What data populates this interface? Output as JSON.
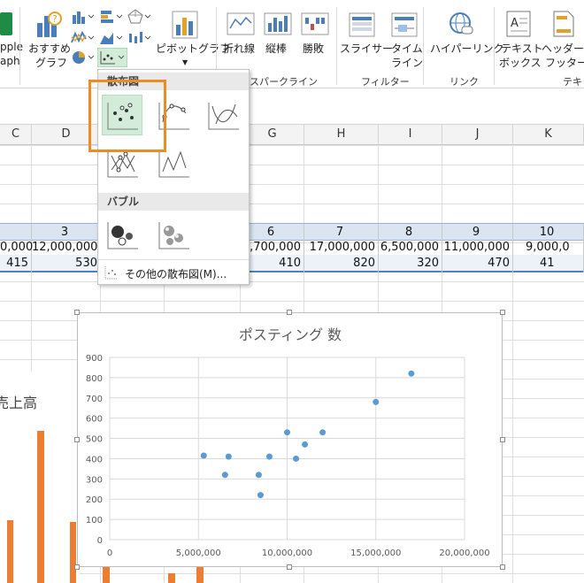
{
  "ribbon": {
    "apple_graph_label_1": "pple",
    "apple_graph_label_2": "aph",
    "recommended_label_1": "おすすめ",
    "recommended_label_2": "グラフ",
    "pivot_label": "ピボットグラフ",
    "line_label": "折れ線",
    "column_label": "縦棒",
    "winloss_label": "勝敗",
    "slicer_label": "スライサー",
    "timeline_label_1": "タイム",
    "timeline_label_2": "ライン",
    "hyperlink_label": "ハイパーリンク",
    "textbox_label_1": "テキスト",
    "textbox_label_2": "ボックス",
    "header_label_1": "ヘッダーと",
    "header_label_2": "フッター",
    "group_sparkline": "スパークライン",
    "group_filter": "フィルター",
    "group_link": "リンク",
    "group_text": "テキ"
  },
  "dropdown": {
    "scatter_header": "散布図",
    "bubble_header": "バブル",
    "more_label": "その他の散布図(M)..."
  },
  "columns": [
    "C",
    "D",
    "",
    "",
    "G",
    "H",
    "I",
    "J",
    "K"
  ],
  "row_numbers": [
    "",
    "3",
    "",
    "",
    "6",
    "7",
    "8",
    "9",
    "10"
  ],
  "row_sales": [
    "0,000",
    "12,000,000",
    "",
    "",
    "6,700,000",
    "17,000,000",
    "6,500,000",
    "11,000,000",
    "9,000,0"
  ],
  "row_posts": [
    "415",
    "530",
    "",
    "",
    "410",
    "820",
    "320",
    "470",
    "41"
  ],
  "bg_chart_title": "売上高",
  "chart_data": {
    "type": "scatter",
    "title": "ポスティング 数",
    "xlim": [
      0,
      20000000
    ],
    "ylim": [
      0,
      900
    ],
    "x_ticks": [
      "0",
      "5,000,000",
      "10,000,000",
      "15,000,000",
      "20,000,000"
    ],
    "y_ticks": [
      "0",
      "100",
      "200",
      "300",
      "400",
      "500",
      "600",
      "700",
      "800",
      "900"
    ],
    "points": [
      {
        "x": 5300000,
        "y": 415
      },
      {
        "x": 6500000,
        "y": 320
      },
      {
        "x": 6700000,
        "y": 410
      },
      {
        "x": 8400000,
        "y": 320
      },
      {
        "x": 8500000,
        "y": 220
      },
      {
        "x": 9000000,
        "y": 410
      },
      {
        "x": 10000000,
        "y": 530
      },
      {
        "x": 10500000,
        "y": 400
      },
      {
        "x": 11000000,
        "y": 470
      },
      {
        "x": 12000000,
        "y": 530
      },
      {
        "x": 15000000,
        "y": 680
      },
      {
        "x": 17000000,
        "y": 820
      }
    ],
    "grid": true,
    "point_color": "#5b9bd5"
  },
  "bg_bar_color": "#ed7d31",
  "highlight_color": "#f08a24"
}
